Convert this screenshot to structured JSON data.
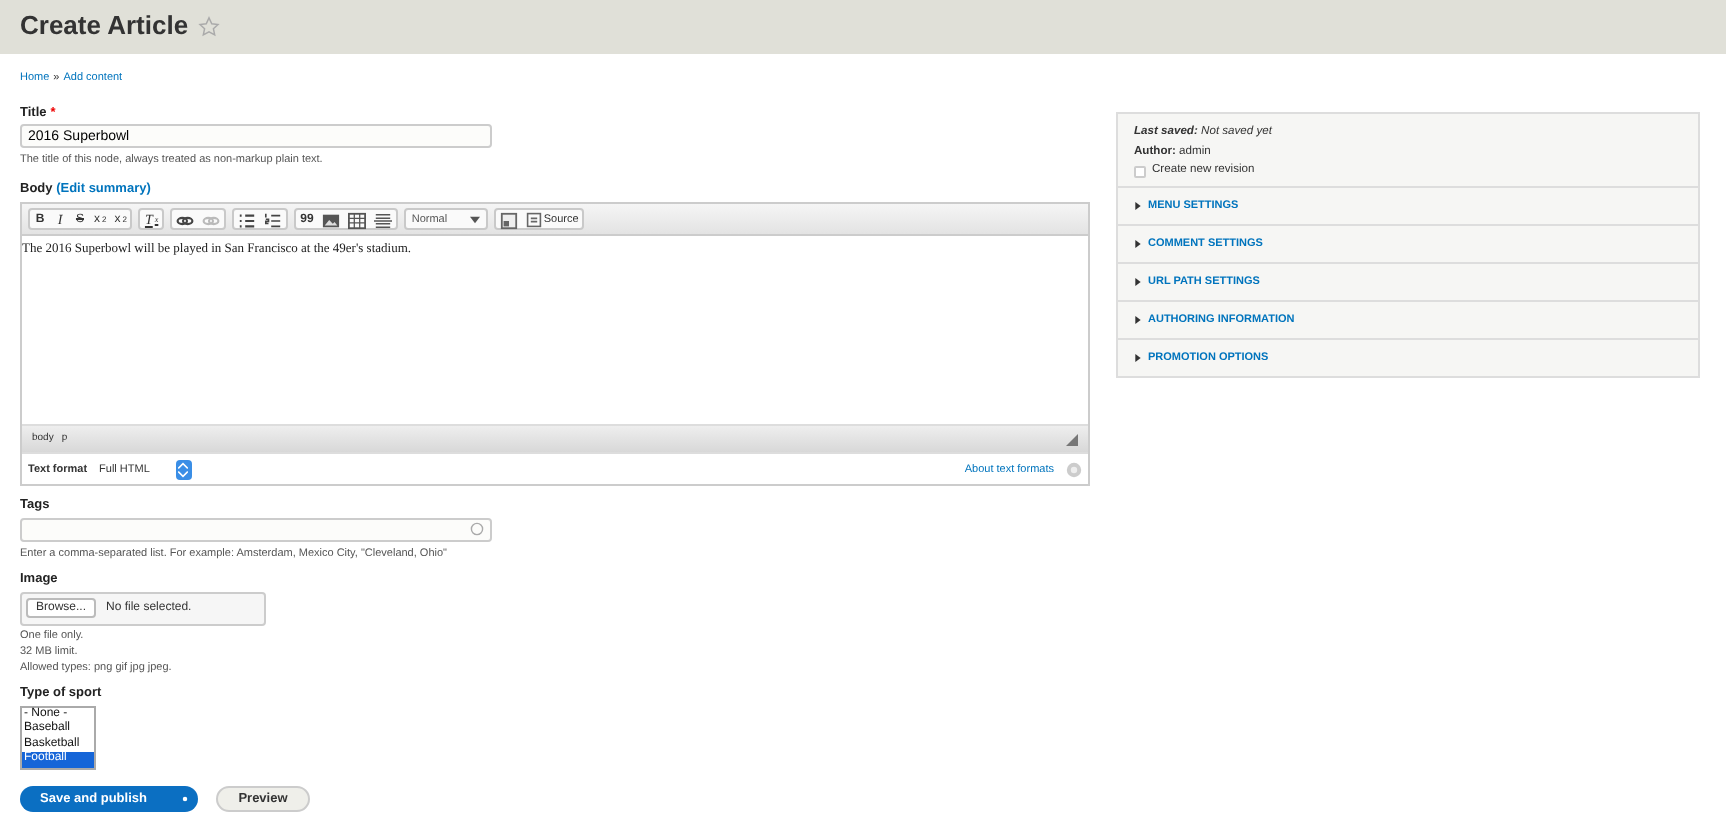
{
  "header": {
    "title": "Create Article",
    "starred": false
  },
  "breadcrumb": [
    "Home",
    "Add content"
  ],
  "breadcrumb_separator": "»",
  "title_field": {
    "label": "Title",
    "required_mark": "*",
    "value": "2016 Superbowl",
    "description": "The title of this node, always treated as non-markup plain text."
  },
  "body": {
    "label": "Body",
    "link_open": "(",
    "link": "Edit summary",
    "link_close": ")",
    "toolbar": [
      [
        {
          "kind": "bold",
          "label": "B"
        },
        {
          "kind": "italic",
          "label": "I"
        },
        {
          "kind": "strike",
          "label": "S"
        },
        {
          "kind": "sup",
          "label": "x",
          "mark": "2"
        },
        {
          "kind": "sub",
          "label": "x",
          "mark": "2"
        }
      ],
      [
        {
          "kind": "clear",
          "label": "T",
          "mark": "x"
        }
      ],
      [
        {
          "kind": "link",
          "disabled": false
        },
        {
          "kind": "unlink",
          "disabled": true
        }
      ],
      [
        {
          "kind": "bullets",
          "disabled": false
        },
        {
          "kind": "numbers",
          "disabled": false
        }
      ],
      [
        {
          "kind": "quote",
          "label": "99"
        },
        {
          "kind": "image",
          "disabled": false
        },
        {
          "kind": "table",
          "disabled": false
        },
        {
          "kind": "rule",
          "disabled": false
        }
      ],
      [
        {
          "kind": "format",
          "label": "Normal"
        }
      ],
      [
        {
          "kind": "maximize",
          "disabled": false
        },
        {
          "kind": "source",
          "label": "Source"
        }
      ]
    ],
    "content": "The 2016 Superbowl will be played in San Francisco at the 49er's stadium.",
    "path": [
      "body",
      "p"
    ],
    "format_label": "Text format",
    "format_value": "Full HTML",
    "about": "About text formats"
  },
  "tags": {
    "label": "Tags",
    "description": "Enter a comma-separated list. For example: Amsterdam, Mexico City, \"Cleveland, Ohio\""
  },
  "image": {
    "label": "Image",
    "browse": "Browse...",
    "status": "No file selected.",
    "notes": [
      "One file only.",
      "32 MB limit.",
      "Allowed types: png gif jpg jpeg."
    ]
  },
  "sport": {
    "label": "Type of sport",
    "options": [
      {
        "label": "- None -",
        "selected": false
      },
      {
        "label": "Baseball",
        "selected": false
      },
      {
        "label": "Basketball",
        "selected": false
      },
      {
        "label": "Football",
        "selected": true
      }
    ]
  },
  "actions": {
    "primary": "Save and publish",
    "secondary": "Preview"
  },
  "sidebar": {
    "last_saved_label": "Last saved:",
    "last_saved": "Not saved yet",
    "author_label": "Author:",
    "author": "admin",
    "revision": {
      "label": "Create new revision",
      "checked": false
    },
    "sections": [
      {
        "label": "MENU SETTINGS",
        "expanded": false
      },
      {
        "label": "COMMENT SETTINGS",
        "expanded": false
      },
      {
        "label": "URL PATH SETTINGS",
        "expanded": false
      },
      {
        "label": "AUTHORING INFORMATION",
        "expanded": false
      },
      {
        "label": "PROMOTION OPTIONS",
        "expanded": false
      }
    ]
  }
}
